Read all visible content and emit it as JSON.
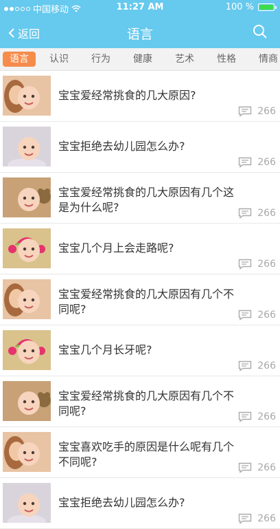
{
  "status": {
    "carrier": "中国移动",
    "time": "11:27 AM",
    "battery": "100 %",
    "signal_bars": 2
  },
  "nav": {
    "back_label": "返回",
    "title": "语言",
    "bg_color": "#66c9ee"
  },
  "tabs": [
    {
      "label": "语言",
      "active": true
    },
    {
      "label": "认识",
      "active": false
    },
    {
      "label": "行为",
      "active": false
    },
    {
      "label": "健康",
      "active": false
    },
    {
      "label": "艺术",
      "active": false
    },
    {
      "label": "性格",
      "active": false
    },
    {
      "label": "情商",
      "active": false
    }
  ],
  "items": [
    {
      "title": "宝宝爱经常挑食的几大原因?",
      "count": "266",
      "thumb": "baby-with-mother"
    },
    {
      "title": "宝宝拒绝去幼儿园怎么办?",
      "count": "266",
      "thumb": "baby-smiling"
    },
    {
      "title": "宝宝爱经常挑食的几大原因有几个这是为什么呢?",
      "count": "266",
      "thumb": "baby-with-toy"
    },
    {
      "title": "宝宝几个月上会走路呢?",
      "count": "266",
      "thumb": "baby-knit-hat"
    },
    {
      "title": "宝宝爱经常挑食的几大原因有几个不同呢?",
      "count": "266",
      "thumb": "baby-with-mother"
    },
    {
      "title": "宝宝几个月长牙呢?",
      "count": "266",
      "thumb": "baby-knit-hat"
    },
    {
      "title": "宝宝爱经常挑食的几大原因有几个不同呢?",
      "count": "266",
      "thumb": "baby-with-toy"
    },
    {
      "title": "宝宝喜欢吃手的原因是什么呢有几个不同呢?",
      "count": "266",
      "thumb": "baby-with-mother"
    },
    {
      "title": "宝宝拒绝去幼儿园怎么办?",
      "count": "266",
      "thumb": "baby-smiling"
    }
  ]
}
